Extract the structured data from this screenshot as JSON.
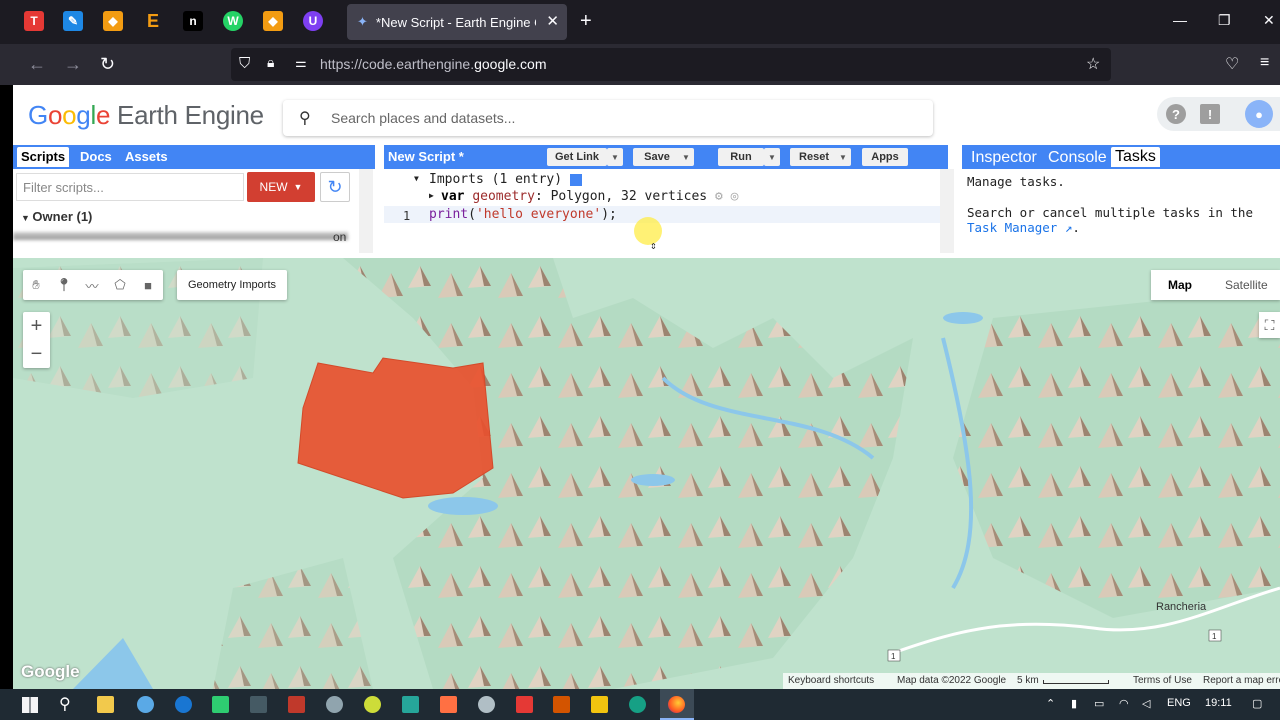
{
  "browser": {
    "tab_title": "*New Script - Earth Engine Code Editor",
    "url_prefix": "https://code.earthengine.",
    "url_domain": "google.com",
    "bookmark_icons": [
      "T",
      "✎",
      "◆",
      "E",
      "n",
      "W",
      "◆",
      "U"
    ]
  },
  "gee": {
    "logo_text": "Earth Engine",
    "search_placeholder": "Search places and datasets...",
    "scripts_panel": {
      "tabs": [
        "Scripts",
        "Docs",
        "Assets"
      ],
      "filter_placeholder": "Filter scripts...",
      "new_label": "NEW",
      "owner_label": "Owner (1)",
      "partial_row_suffix": "on"
    },
    "editor": {
      "title": "New Script *",
      "buttons": {
        "get_link": "Get Link",
        "save": "Save",
        "run": "Run",
        "reset": "Reset",
        "apps": "Apps"
      },
      "imports_line": "Imports (1 entry)",
      "var_kw": "var",
      "var_name": "geometry",
      "var_value": ": Polygon, 32 vertices",
      "line_number": "1",
      "code_fn": "print",
      "code_arg": "'hello everyone'",
      "code_end": ");"
    },
    "right_panel": {
      "tabs": [
        "Inspector",
        "Console",
        "Tasks"
      ],
      "active_tab": "Tasks",
      "line1": "Manage tasks.",
      "line2": "Search or cancel multiple tasks in the",
      "link": "Task Manager",
      "link_end": "."
    },
    "map": {
      "geometry_imports": "Geometry Imports",
      "zoom_in": "+",
      "zoom_out": "−",
      "map_type": [
        "Map",
        "Satellite"
      ],
      "selected_map_type": "Map",
      "place_label": "Rancheria",
      "road_shields": [
        "1",
        "1"
      ],
      "google_mark": "Google",
      "attribution": {
        "shortcuts": "Keyboard shortcuts",
        "data": "Map data ©2022 Google",
        "scale": "5 km",
        "terms": "Terms of Use",
        "report": "Report a map error"
      },
      "polygon_color": "#e8502e"
    }
  },
  "taskbar": {
    "language": "ENG",
    "time": "19:11"
  }
}
